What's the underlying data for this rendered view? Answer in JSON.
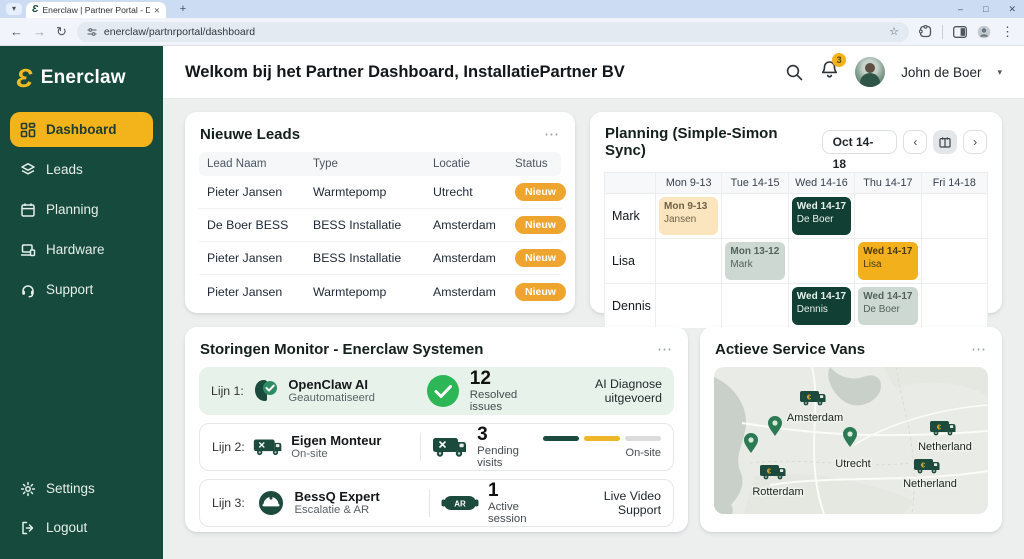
{
  "browser": {
    "tab_title": "Enerclaw | Partner Portal - Das",
    "url": "enerclaw/partnrportal/dashboard"
  },
  "glyphs": {
    "brand": "Ɛ",
    "tab_caret": "▾",
    "tab_close": "✕",
    "new_tab": "+",
    "win_minimize": "–",
    "win_maximize": "□",
    "win_close": "✕",
    "nav_back": "←",
    "nav_forward": "→",
    "nav_reload": "↻",
    "bookmark_star": "☆",
    "menu_kebab": "⋮",
    "ellipsis": "⋯",
    "chevron_left": "‹",
    "chevron_right": "›",
    "caret_down": "▾",
    "van_logo": "€"
  },
  "sidebar": {
    "brand": "Enerclaw",
    "items": [
      {
        "label": "Dashboard"
      },
      {
        "label": "Leads"
      },
      {
        "label": "Planning"
      },
      {
        "label": "Hardware"
      },
      {
        "label": "Support"
      }
    ],
    "footer_items": [
      {
        "label": "Settings"
      },
      {
        "label": "Logout"
      }
    ]
  },
  "header": {
    "title": "Welkom bij het Partner Dashboard, InstallatiePartner BV",
    "notification_count": "3",
    "user_name": "John de Boer"
  },
  "leads": {
    "title": "Nieuwe Leads",
    "columns": [
      "Lead Naam",
      "Type",
      "Locatie",
      "Status"
    ],
    "rows": [
      {
        "name": "Pieter Jansen",
        "type": "Warmtepomp",
        "location": "Utrecht",
        "status": "Nieuw"
      },
      {
        "name": "De Boer BESS",
        "type": "BESS Installatie",
        "location": "Amsterdam",
        "status": "Nieuw"
      },
      {
        "name": "Pieter Jansen",
        "type": "BESS Installatie",
        "location": "Amsterdam",
        "status": "Nieuw"
      },
      {
        "name": "Pieter Jansen",
        "type": "Warmtepomp",
        "location": "Amsterdam",
        "status": "Nieuw"
      }
    ]
  },
  "planning": {
    "title": "Planning (Simple-Simon Sync)",
    "date_range": "Oct 14-18",
    "days": [
      "Mon 9-13",
      "Tue 14-15",
      "Wed 14-16",
      "Thu 14-17",
      "Fri 14-18"
    ],
    "resources": [
      "Mark",
      "Lisa",
      "Dennis"
    ],
    "events": [
      {
        "time": "Mon 9-13",
        "who": "Jansen"
      },
      {
        "time": "Wed 14-17",
        "who": "De Boer"
      },
      {
        "time": "Mon 13-12",
        "who": "Mark"
      },
      {
        "time": "Wed 14-17",
        "who": "Lisa"
      },
      {
        "time": "Wed 14-17",
        "who": "Dennis"
      },
      {
        "time": "Wed 14-17",
        "who": "De Boer"
      }
    ]
  },
  "monitor": {
    "title": "Storingen Monitor - Enerclaw Systemen",
    "rows": [
      {
        "label": "Lijn 1:",
        "name": "OpenClaw AI",
        "sub": "Geautomatiseerd",
        "value": "12",
        "value_label": "Resolved issues",
        "note": "AI Diagnose uitgevoerd"
      },
      {
        "label": "Lijn 2:",
        "name": "Eigen Monteur",
        "sub": "On-site",
        "value": "3",
        "value_label": "Pending visits",
        "note": "On-site"
      },
      {
        "label": "Lijn 3:",
        "name": "BessQ Expert",
        "sub": "Escalatie & AR",
        "value": "1",
        "value_label": "Active session",
        "note": "Live Video Support",
        "badge": "AR"
      }
    ]
  },
  "vans": {
    "title": "Actieve Service Vans",
    "labels": [
      "Amsterdam",
      "Netherland",
      "Netherland",
      "Utrecht",
      "Rotterdam"
    ]
  },
  "colors": {
    "brand_green": "#164A3C",
    "brand_amber": "#F2B31B",
    "badge_amber": "#EDA52F",
    "event_dark_green": "#123F33",
    "event_cream": "#FBE5BE",
    "event_sage": "#CCD8D1",
    "event_amber": "#F2B01C",
    "success_green": "#2CB656",
    "row_green_bg": "#E7F3EA",
    "progress_dark": "#1C4A3C",
    "progress_amber": "#EFB62A",
    "progress_gray": "#DCDCDC"
  }
}
